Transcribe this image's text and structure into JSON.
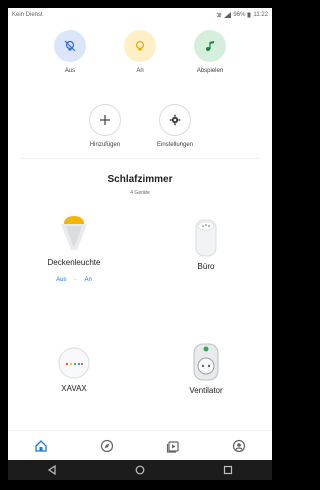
{
  "status_bar": {
    "carrier": "Kein Dienst",
    "battery": "96%",
    "time": "11:22"
  },
  "quick_actions": [
    {
      "label": "Aus",
      "icon": "lightbulb-off-icon"
    },
    {
      "label": "An",
      "icon": "lightbulb-icon"
    },
    {
      "label": "Abspielen",
      "icon": "music-note-icon"
    }
  ],
  "secondary_actions": [
    {
      "label": "Hinzufügen",
      "icon": "plus-icon"
    },
    {
      "label": "Einstellungen",
      "icon": "gear-icon"
    }
  ],
  "room": {
    "title": "Schlafzimmer",
    "subtitle": "4 Geräte",
    "devices": [
      {
        "name": "Deckenleuchte",
        "icon": "ceiling-light-icon",
        "controls": {
          "off": "Aus",
          "on": "An"
        }
      },
      {
        "name": "Büro",
        "icon": "smart-speaker-icon"
      },
      {
        "name": "XAVAX",
        "icon": "smart-plug-icon"
      },
      {
        "name": "Ventilator",
        "icon": "smart-plug-icon"
      }
    ]
  },
  "bottom_nav": [
    "home-icon",
    "explore-icon",
    "media-icon",
    "account-icon"
  ],
  "system_nav": [
    "back-icon",
    "home-circle-icon",
    "recents-icon"
  ],
  "colors": {
    "accent": "#1a73e8",
    "light_on": "#f4b400",
    "green": "#188038"
  }
}
